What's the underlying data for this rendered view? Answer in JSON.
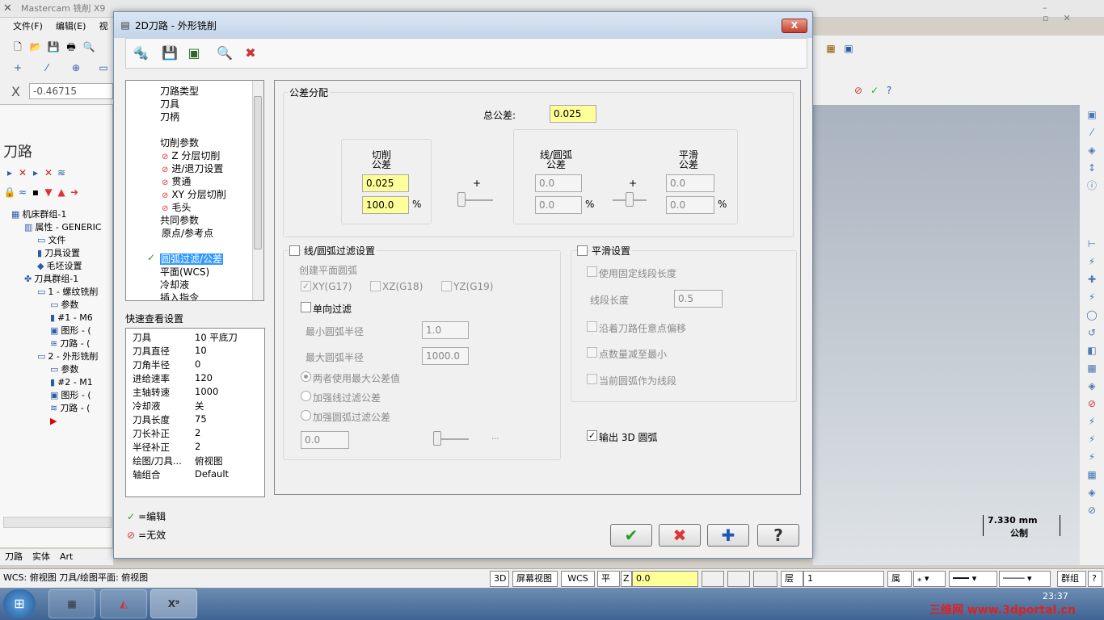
{
  "app": {
    "title": "Mastercam 铣削 X9",
    "menu": [
      "文件(F)",
      "编辑(E)",
      "视图"
    ],
    "coord_label": "X",
    "coord_value": "-0.46715"
  },
  "left_panel": {
    "title": "刀路",
    "tree": [
      {
        "label": "机床群组-1",
        "indent": 0,
        "icon": "machine-group-icon"
      },
      {
        "label": "属性 - GENERIC",
        "indent": 1,
        "icon": "properties-icon"
      },
      {
        "label": "文件",
        "indent": 2,
        "icon": "folder-icon"
      },
      {
        "label": "刀具设置",
        "indent": 2,
        "icon": "tool-icon"
      },
      {
        "label": "毛坯设置",
        "indent": 2,
        "icon": "stock-icon"
      },
      {
        "label": "刀具群组-1",
        "indent": 1,
        "icon": "tool-group-icon"
      },
      {
        "label": "1 - 螺纹铣削",
        "indent": 2,
        "icon": "operation-folder-icon"
      },
      {
        "label": "参数",
        "indent": 3,
        "icon": "params-icon"
      },
      {
        "label": "#1 - M6",
        "indent": 3,
        "icon": "tool-icon"
      },
      {
        "label": "图形 - (",
        "indent": 3,
        "icon": "geometry-icon"
      },
      {
        "label": "刀路 - (",
        "indent": 3,
        "icon": "toolpath-icon"
      },
      {
        "label": "2 - 外形铣削",
        "indent": 2,
        "icon": "operation-folder-icon"
      },
      {
        "label": "参数",
        "indent": 3,
        "icon": "params-icon"
      },
      {
        "label": "#2 - M1",
        "indent": 3,
        "icon": "tool-icon"
      },
      {
        "label": "图形 - (",
        "indent": 3,
        "icon": "geometry-icon"
      },
      {
        "label": "刀路 - (",
        "indent": 3,
        "icon": "toolpath-icon"
      }
    ],
    "bottom_tabs": [
      "刀路",
      "实体",
      "Art"
    ]
  },
  "dialog": {
    "title": "2D刀路 - 外形铣削",
    "close": "X",
    "nav_tree": [
      {
        "label": "刀路类型",
        "state": "none",
        "depth": 0
      },
      {
        "label": "刀具",
        "state": "none",
        "depth": 0
      },
      {
        "label": "刀柄",
        "state": "none",
        "depth": 0
      },
      {
        "label": "",
        "state": "none",
        "depth": 0
      },
      {
        "label": "切削参数",
        "state": "none",
        "depth": 0
      },
      {
        "label": "Z 分层切削",
        "state": "invalid",
        "depth": 1
      },
      {
        "label": "进/退刀设置",
        "state": "invalid",
        "depth": 1
      },
      {
        "label": "贯通",
        "state": "invalid",
        "depth": 1
      },
      {
        "label": "XY 分层切削",
        "state": "invalid",
        "depth": 1
      },
      {
        "label": "毛头",
        "state": "invalid",
        "depth": 1
      },
      {
        "label": "共同参数",
        "state": "none",
        "depth": 0
      },
      {
        "label": "原点/参考点",
        "state": "none",
        "depth": 1
      },
      {
        "label": "",
        "state": "none",
        "depth": 0
      },
      {
        "label": "圆弧过滤/公差",
        "state": "edited",
        "depth": 0
      },
      {
        "label": "平面(WCS)",
        "state": "none",
        "depth": 0
      },
      {
        "label": "冷却液",
        "state": "none",
        "depth": 0
      },
      {
        "label": "插入指令",
        "state": "none",
        "depth": 0
      }
    ],
    "quickview": {
      "title": "快速查看设置",
      "rows": [
        {
          "k": "刀具",
          "v": "10 平底刀"
        },
        {
          "k": "刀具直径",
          "v": "10"
        },
        {
          "k": "刀角半径",
          "v": "0"
        },
        {
          "k": "进给速率",
          "v": "120"
        },
        {
          "k": "主轴转速",
          "v": "1000"
        },
        {
          "k": "冷却液",
          "v": "关"
        },
        {
          "k": "刀具长度",
          "v": "75"
        },
        {
          "k": "刀长补正",
          "v": "2"
        },
        {
          "k": "半径补正",
          "v": "2"
        },
        {
          "k": "绘图/刀具...",
          "v": "俯视图"
        },
        {
          "k": "轴组合",
          "v": "Default"
        }
      ]
    },
    "legend": {
      "edit": "=编辑",
      "invalid": "=无效"
    },
    "tolerance": {
      "group_title": "公差分配",
      "total_label": "总公差:",
      "total_value": "0.025",
      "cut_label": "切削\n公差",
      "cut_value": "0.025",
      "cut_percent": "100.0",
      "percent_sign": "%",
      "plus": "+",
      "line_arc_label": "线/圆弧\n公差",
      "line_arc_value": "0.0",
      "line_arc_percent": "0.0",
      "smooth_label": "平滑\n公差",
      "smooth_value": "0.0",
      "smooth_percent": "0.0"
    },
    "arc_filter": {
      "title": "线/圆弧过滤设置",
      "create_plane_arc": "创建平面圆弧",
      "xy": "XY(G17)",
      "xz": "XZ(G18)",
      "yz": "YZ(G19)",
      "one_way": "单向过滤",
      "min_radius_label": "最小圆弧半径",
      "min_radius": "1.0",
      "max_radius_label": "最大圆弧半径",
      "max_radius": "1000.0",
      "opt_both": "两者使用最大公差值",
      "opt_line": "加强线过滤公差",
      "opt_arc": "加强圆弧过滤公差",
      "filter_value": "0.0",
      "ellipsis": "..."
    },
    "smoothing": {
      "title": "平滑设置",
      "fixed_seg": "使用固定线段长度",
      "seg_len_label": "线段长度",
      "seg_len": "0.5",
      "along_offset": "沿着刀路任意点偏移",
      "reduce_points": "点数量减至最小",
      "arc_as_seg": "当前圆弧作为线段"
    },
    "output_3d_arc": "输出 3D 圆弧",
    "buttons": {
      "ok": "✔",
      "cancel": "✖",
      "apply": "✚",
      "help": "?"
    }
  },
  "status_bar": {
    "text": "WCS: 俯视图  刀具/绘图平面: 俯视图",
    "btn_3d": "3D",
    "screen_view": "屏幕视图",
    "wcs": "WCS",
    "plane": "平面",
    "z_label": "Z",
    "z_value": "0.0",
    "layer_label": "层别",
    "layer_value": "1",
    "attr": "属性",
    "group": "群组",
    "help": "?"
  },
  "scale": {
    "value": "7.330 mm",
    "caption": "公制"
  },
  "taskbar": {
    "clock": "23:37",
    "watermark": "三维网 www.3dportal.cn"
  }
}
